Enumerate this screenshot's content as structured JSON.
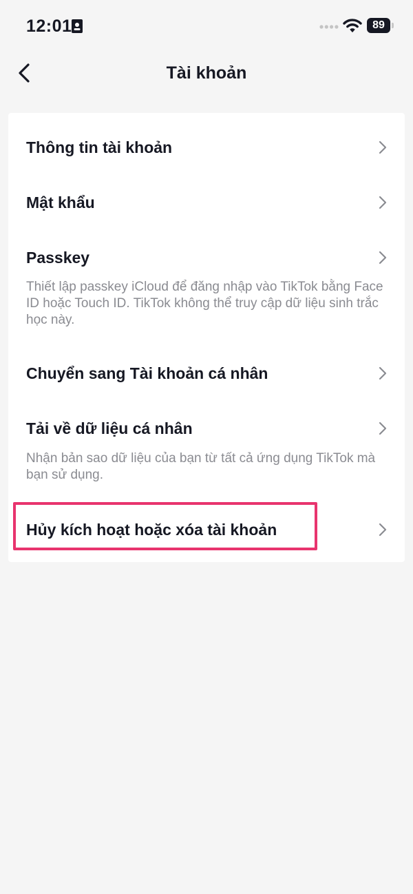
{
  "status_bar": {
    "time": "12:01",
    "battery": "89"
  },
  "header": {
    "title": "Tài khoản"
  },
  "menu": [
    {
      "title": "Thông tin tài khoản"
    },
    {
      "title": "Mật khẩu"
    },
    {
      "title": "Passkey",
      "description": "Thiết lập passkey iCloud để đăng nhập vào TikTok bằng Face ID hoặc Touch ID. TikTok không thể truy cập dữ liệu sinh trắc học này."
    },
    {
      "title": "Chuyển sang Tài khoản cá nhân"
    },
    {
      "title": "Tải về dữ liệu cá nhân",
      "description": "Nhận bản sao dữ liệu của bạn từ tất cả ứng dụng TikTok mà bạn sử dụng."
    },
    {
      "title": "Hủy kích hoạt hoặc xóa tài khoản"
    }
  ],
  "colors": {
    "background": "#f5f5f5",
    "card": "#ffffff",
    "text": "#161823",
    "secondary_text": "#8a8b91",
    "highlight_border": "#e8346e"
  },
  "icons": {
    "back": "chevron-left-icon",
    "row": "chevron-right-icon",
    "wifi": "wifi-icon",
    "status": "id-card-icon"
  }
}
